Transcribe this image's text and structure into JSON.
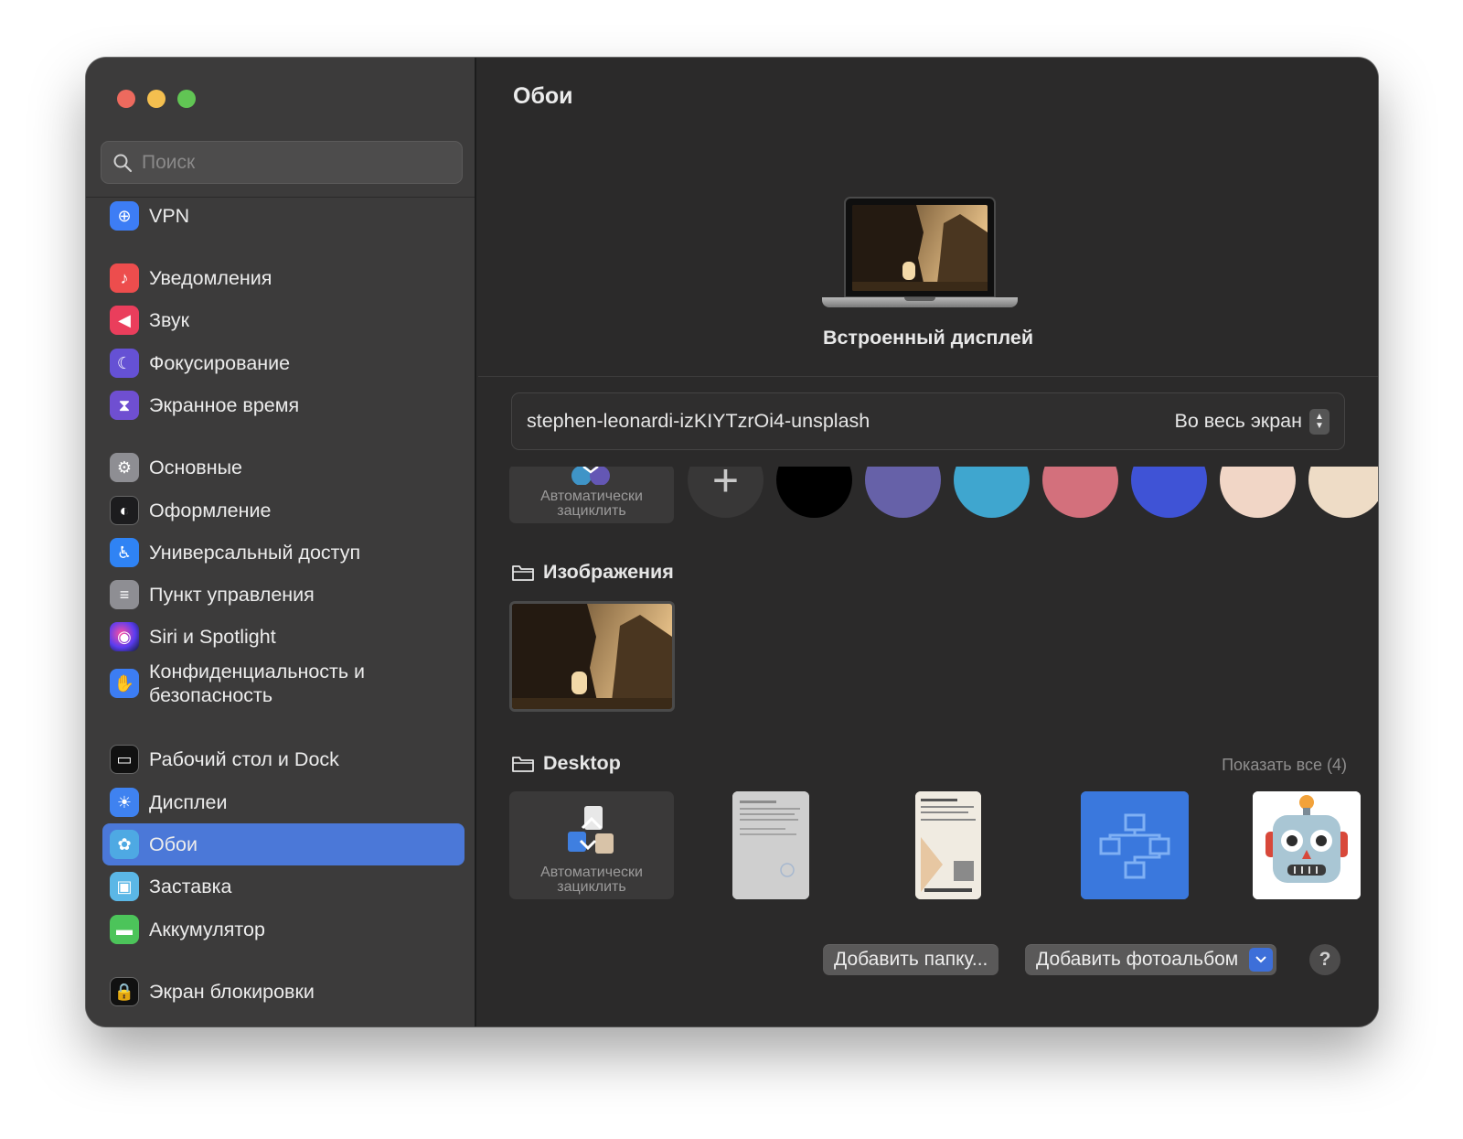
{
  "window": {
    "title": "Обои"
  },
  "search": {
    "placeholder": "Поиск"
  },
  "sidebar": {
    "items": [
      {
        "key": "vpn",
        "label": "VPN",
        "icon": "globe-icon",
        "color": "#3d7df5"
      },
      {
        "key": "notifications",
        "label": "Уведомления",
        "icon": "bell-icon",
        "color": "#ed4d4d"
      },
      {
        "key": "sound",
        "label": "Звук",
        "icon": "speaker-icon",
        "color": "#ea3e5c"
      },
      {
        "key": "focus",
        "label": "Фокусирование",
        "icon": "moon-icon",
        "color": "#6551d4"
      },
      {
        "key": "screentime",
        "label": "Экранное время",
        "icon": "hourglass-icon",
        "color": "#6f4fd1"
      },
      {
        "key": "general",
        "label": "Основные",
        "icon": "gear-icon",
        "color": "#8e8e93"
      },
      {
        "key": "appearance",
        "label": "Оформление",
        "icon": "appearance-icon",
        "color": "#1c1c1e"
      },
      {
        "key": "accessibility",
        "label": "Универсальный доступ",
        "icon": "accessibility-icon",
        "color": "#2f83f4"
      },
      {
        "key": "controlcenter",
        "label": "Пункт управления",
        "icon": "toggles-icon",
        "color": "#8e8e93"
      },
      {
        "key": "siri",
        "label": "Siri и Spotlight",
        "icon": "siri-icon",
        "color": "#2a2a2a"
      },
      {
        "key": "privacy",
        "label": "Конфиденциальность и безопасность",
        "icon": "hand-icon",
        "color": "#3c7df3"
      },
      {
        "key": "desktopdock",
        "label": "Рабочий стол и Dock",
        "icon": "dock-icon",
        "color": "#111111"
      },
      {
        "key": "displays",
        "label": "Дисплеи",
        "icon": "sun-icon",
        "color": "#3f82f0"
      },
      {
        "key": "wallpaper",
        "label": "Обои",
        "icon": "flower-icon",
        "color": "#4ea9e3",
        "active": true
      },
      {
        "key": "screensaver",
        "label": "Заставка",
        "icon": "screensaver-icon",
        "color": "#5bb7e6"
      },
      {
        "key": "battery",
        "label": "Аккумулятор",
        "icon": "battery-icon",
        "color": "#4cc45a"
      },
      {
        "key": "lockscreen",
        "label": "Экран блокировки",
        "icon": "lock-icon",
        "color": "#111111"
      }
    ]
  },
  "main": {
    "title": "Обои",
    "display_name": "Встроенный дисплей",
    "wallpaper_name": "stephen-leonardi-izKIYTzrOi4-unsplash",
    "fit_option": "Во весь экран",
    "auto_cycle_label": "Автоматически зациклить",
    "swatches": [
      "#000000",
      "#6661a8",
      "#3fa6cf",
      "#d3707c",
      "#3f53d6",
      "#f1d6c6",
      "#eedcc6"
    ],
    "images_section": {
      "title": "Изображения"
    },
    "desktop_section": {
      "title": "Desktop",
      "show_all": "Показать все (4)"
    },
    "buttons": {
      "add_folder": "Добавить папку...",
      "add_album": "Добавить фотоальбом",
      "help": "?"
    }
  }
}
